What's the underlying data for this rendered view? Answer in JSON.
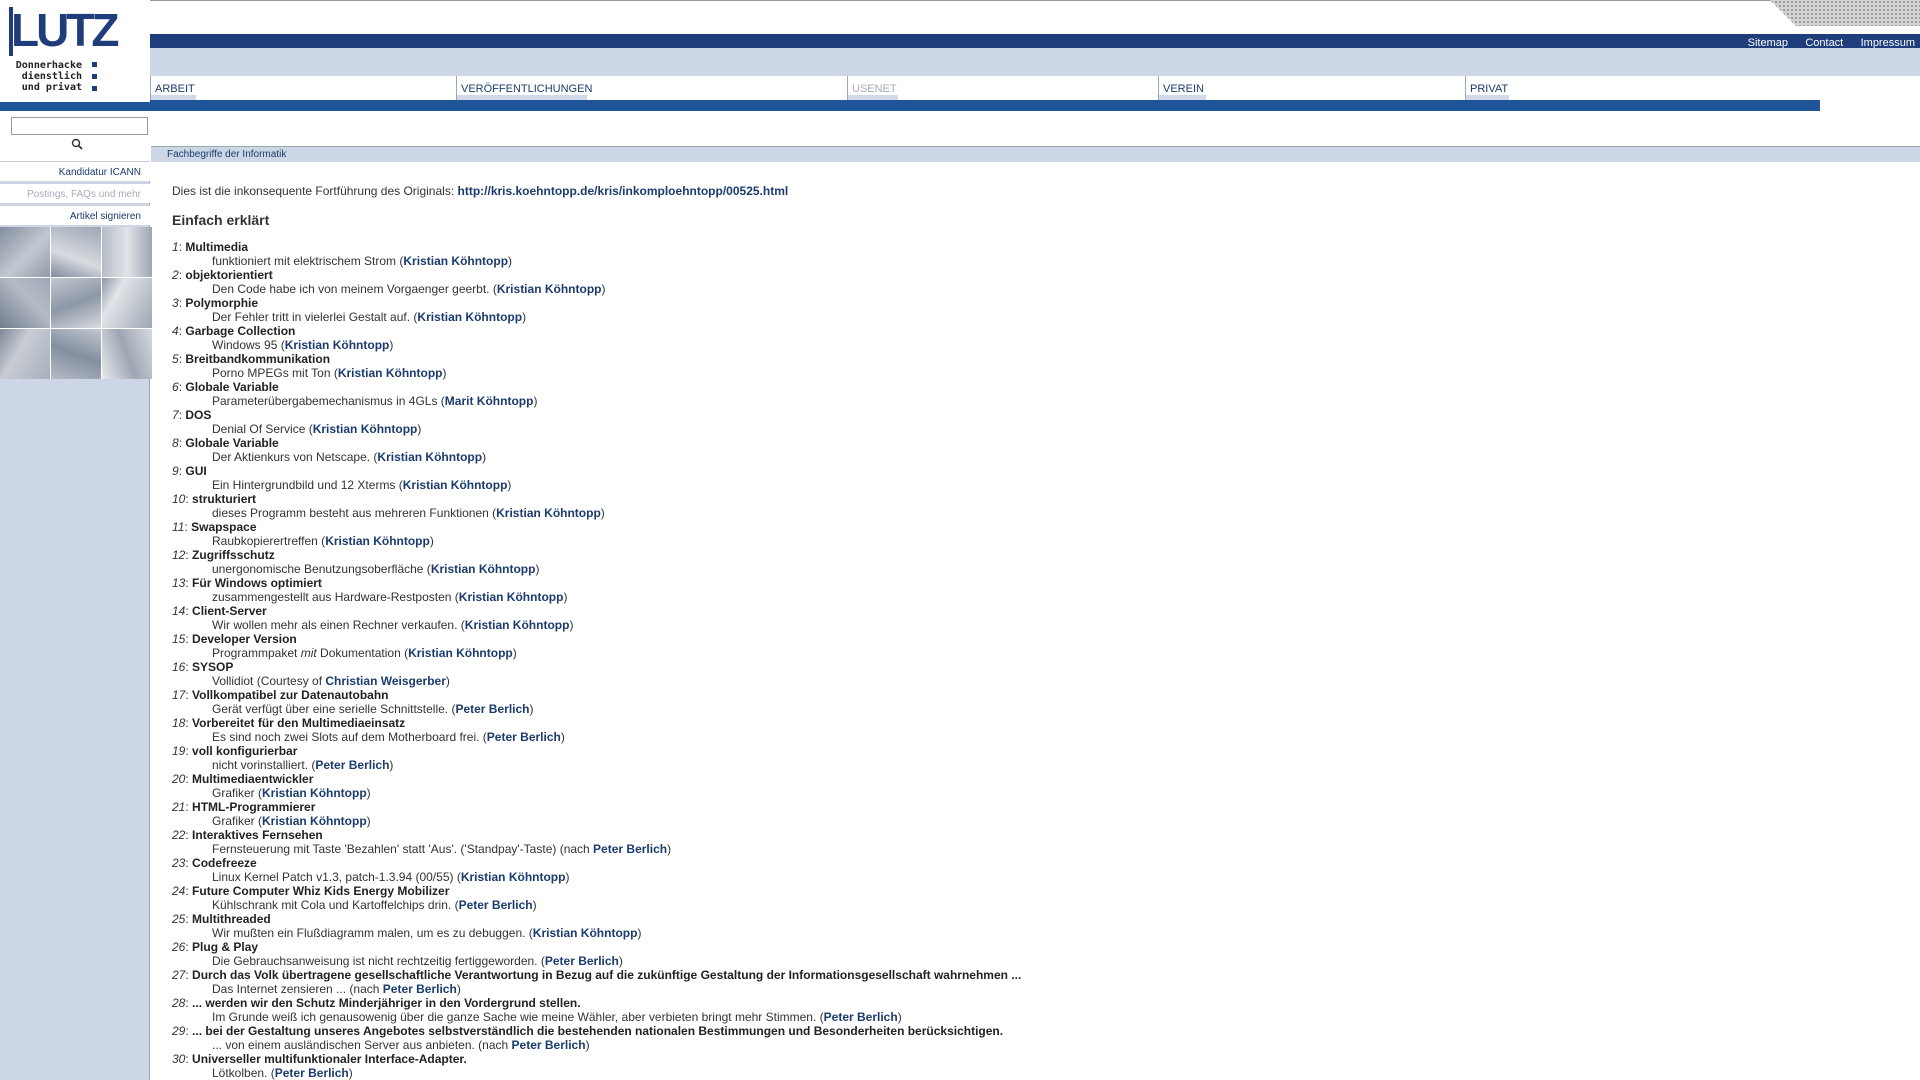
{
  "logo": {
    "word": "LUTZ",
    "sub": [
      "Donnerhacke",
      "dienstlich",
      "und privat"
    ]
  },
  "utility": [
    "Sitemap",
    "Contact",
    "Impressum"
  ],
  "menu": [
    {
      "label": "Arbeit",
      "disabled": false
    },
    {
      "label": "Veröffentlichungen",
      "disabled": false
    },
    {
      "label": "Usenet",
      "disabled": true
    },
    {
      "label": "Verein",
      "disabled": false
    },
    {
      "label": "Privat",
      "disabled": false
    }
  ],
  "sidebar": {
    "search_value": "",
    "links": [
      {
        "label": "Kandidatur ICANN",
        "state": "active"
      },
      {
        "label": "Postings, FAQs und mehr",
        "state": "muted"
      },
      {
        "label": "Artikel signieren",
        "state": "active"
      }
    ]
  },
  "breadcrumb": "Fachbegriffe der Informatik",
  "intro": {
    "text": "Dies ist die inkonsequente Fortführung des Originals: ",
    "link": "http://kris.koehntopp.de/kris/inkomploehntopp/00525.html"
  },
  "heading": "Einfach erklärt",
  "entries": [
    {
      "n": "1",
      "term": "Multimedia",
      "pre": "funktioniert mit elektrischem Strom (",
      "author": "Kristian Köhntopp",
      "post": ")"
    },
    {
      "n": "2",
      "term": "objektorientiert",
      "pre": "Den Code habe ich von meinem Vorgaenger geerbt. (",
      "author": "Kristian Köhntopp",
      "post": ")"
    },
    {
      "n": "3",
      "term": "Polymorphie",
      "pre": "Der Fehler tritt in vielerlei Gestalt auf. (",
      "author": "Kristian Köhntopp",
      "post": ")"
    },
    {
      "n": "4",
      "term": "Garbage Collection",
      "pre": "Windows 95 (",
      "author": "Kristian Köhntopp",
      "post": ")"
    },
    {
      "n": "5",
      "term": "Breitbandkommunikation",
      "pre": "Porno MPEGs mit Ton (",
      "author": "Kristian Köhntopp",
      "post": ")"
    },
    {
      "n": "6",
      "term": "Globale Variable",
      "pre": "Parameterübergabemechanismus in 4GLs (",
      "author": "Marit Köhntopp",
      "post": ")"
    },
    {
      "n": "7",
      "term": "DOS",
      "pre": "Denial Of Service (",
      "author": "Kristian Köhntopp",
      "post": ")"
    },
    {
      "n": "8",
      "term": "Globale Variable",
      "pre": "Der Aktienkurs von Netscape. (",
      "author": "Kristian Köhntopp",
      "post": ")"
    },
    {
      "n": "9",
      "term": "GUI",
      "pre": "Ein Hintergrundbild und 12 Xterms (",
      "author": "Kristian Köhntopp",
      "post": ")"
    },
    {
      "n": "10",
      "term": "strukturiert",
      "pre": "dieses Programm besteht aus mehreren Funktionen (",
      "author": "Kristian Köhntopp",
      "post": ")"
    },
    {
      "n": "11",
      "term": "Swapspace",
      "pre": "Raubkopierertreffen (",
      "author": "Kristian Köhntopp",
      "post": ")"
    },
    {
      "n": "12",
      "term": "Zugriffsschutz",
      "pre": "unergonomische Benutzungsoberfläche (",
      "author": "Kristian Köhntopp",
      "post": ")"
    },
    {
      "n": "13",
      "term": "Für Windows optimiert",
      "pre": "zusammengestellt aus Hardware-Restposten (",
      "author": "Kristian Köhntopp",
      "post": ")"
    },
    {
      "n": "14",
      "term": "Client-Server",
      "pre": "Wir wollen mehr als einen Rechner verkaufen. (",
      "author": "Kristian Köhntopp",
      "post": ")"
    },
    {
      "n": "15",
      "term": "Developer Version",
      "pre": "Programmpaket ",
      "em": "mit",
      "pre2": " Dokumentation (",
      "author": "Kristian Köhntopp",
      "post": ")"
    },
    {
      "n": "16",
      "term": "SYSOP",
      "pre": "Vollidiot (Courtesy of ",
      "author": "Christian Weisgerber",
      "post": ")"
    },
    {
      "n": "17",
      "term": "Vollkompatibel zur Datenautobahn",
      "pre": "Gerät verfügt über eine serielle Schnittstelle. (",
      "author": "Peter Berlich",
      "post": ")"
    },
    {
      "n": "18",
      "term": "Vorbereitet für den Multimediaeinsatz",
      "pre": "Es sind noch zwei Slots auf dem Motherboard frei. (",
      "author": "Peter Berlich",
      "post": ")"
    },
    {
      "n": "19",
      "term": "voll konfigurierbar",
      "pre": "nicht vorinstalliert. (",
      "author": "Peter Berlich",
      "post": ")"
    },
    {
      "n": "20",
      "term": "Multimediaentwickler",
      "pre": "Grafiker (",
      "author": "Kristian Köhntopp",
      "post": ")"
    },
    {
      "n": "21",
      "term": "HTML-Programmierer",
      "pre": "Grafiker (",
      "author": "Kristian Köhntopp",
      "post": ")"
    },
    {
      "n": "22",
      "term": "Interaktives Fernsehen",
      "pre": "Fernsteuerung mit Taste 'Bezahlen' statt 'Aus'. ('Standpay'-Taste) (nach ",
      "author": "Peter Berlich",
      "post": ")"
    },
    {
      "n": "23",
      "term": "Codefreeze",
      "pre": "Linux Kernel Patch v1.3, patch-1.3.94 (00/55) (",
      "author": "Kristian Köhntopp",
      "post": ")"
    },
    {
      "n": "24",
      "term": "Future Computer Whiz Kids Energy Mobilizer",
      "pre": "Kühlschrank mit Cola und Kartoffelchips drin. (",
      "author": "Peter Berlich",
      "post": ")"
    },
    {
      "n": "25",
      "term": "Multithreaded",
      "pre": "Wir mußten ein Flußdiagramm malen, um es zu debuggen. (",
      "author": "Kristian Köhntopp",
      "post": ")"
    },
    {
      "n": "26",
      "term": "Plug & Play",
      "pre": "Die Gebrauchsanweisung ist nicht rechtzeitig fertiggeworden. (",
      "author": "Peter Berlich",
      "post": ")"
    },
    {
      "n": "27",
      "term": "Durch das Volk übertragene gesellschaftliche Verantwortung in Bezug auf die zukünftige Gestaltung der Informationsgesellschaft wahrnehmen ...",
      "pre": "Das Internet zensieren ... (nach ",
      "author": "Peter Berlich",
      "post": ")"
    },
    {
      "n": "28",
      "term": "... werden wir den Schutz Minderjähriger in den Vordergrund stellen.",
      "pre": "Im Grunde weiß ich genausowenig über die ganze Sache wie meine Wähler, aber verbieten bringt mehr Stimmen. (",
      "author": "Peter Berlich",
      "post": ")"
    },
    {
      "n": "29",
      "term": "... bei der Gestaltung unseres Angebotes selbstverständlich die bestehenden nationalen Bestimmungen und Besonderheiten berücksichtigen.",
      "pre": "... von einem ausländischen Server aus anbieten. (nach ",
      "author": "Peter Berlich",
      "post": ")"
    },
    {
      "n": "30",
      "term": "Universeller multifunktionaler Interface-Adapter.",
      "pre": "Lötkolben. (",
      "author": "Peter Berlich",
      "post": ")"
    }
  ]
}
